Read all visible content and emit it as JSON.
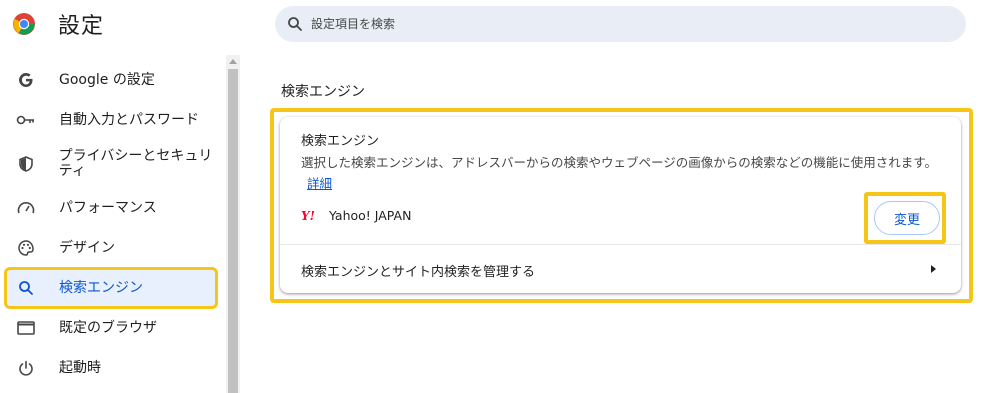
{
  "header": {
    "title": "設定",
    "logo_icon": "chrome-logo-icon",
    "search_placeholder": "設定項目を検索"
  },
  "sidebar": {
    "items": [
      {
        "label": "Google の設定",
        "icon": "google-g-icon",
        "active": false
      },
      {
        "label": "自動入力とパスワード",
        "icon": "key-icon",
        "active": false
      },
      {
        "label": "プライバシーとセキュリティ",
        "icon": "shield-icon",
        "active": false
      },
      {
        "label": "パフォーマンス",
        "icon": "speedometer-icon",
        "active": false
      },
      {
        "label": "デザイン",
        "icon": "palette-icon",
        "active": false
      },
      {
        "label": "検索エンジン",
        "icon": "search-icon",
        "active": true
      },
      {
        "label": "既定のブラウザ",
        "icon": "browser-window-icon",
        "active": false
      },
      {
        "label": "起動時",
        "icon": "power-icon",
        "active": false
      }
    ]
  },
  "main": {
    "section_title": "検索エンジン",
    "card": {
      "title": "検索エンジン",
      "description": "選択した検索エンジンは、アドレスバーからの検索やウェブページの画像からの検索などの機能に使用されます。",
      "details_link": "詳細",
      "engine_logo": "Y!",
      "engine_name": "Yahoo! JAPAN",
      "change_button": "変更",
      "manage_label": "検索エンジンとサイト内検索を管理する"
    }
  },
  "colors": {
    "accent": "#0b57d0",
    "highlight": "#f5c518",
    "active_bg": "#e8f0fe",
    "search_bg": "#e9eef6"
  }
}
